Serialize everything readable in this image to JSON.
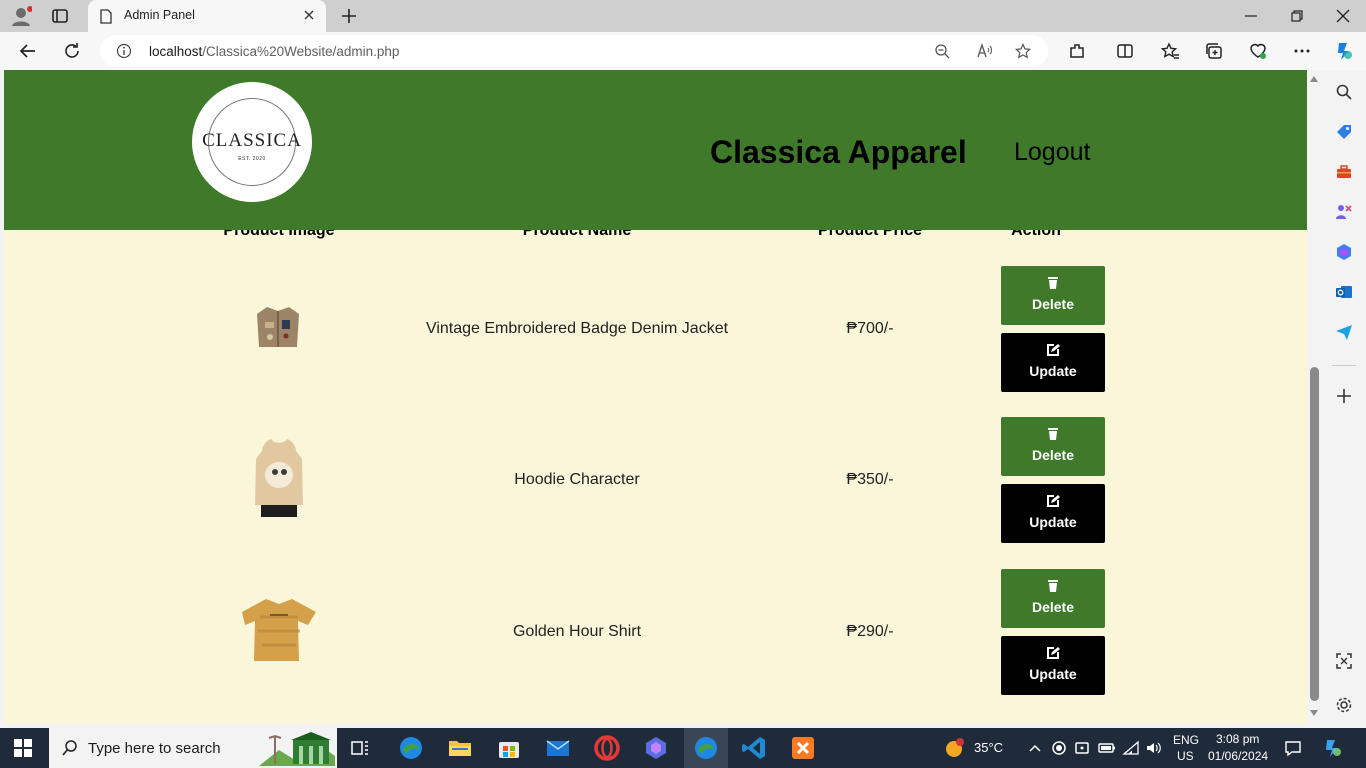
{
  "browser": {
    "tab_title": "Admin Panel",
    "url_host": "localhost",
    "url_path": "/Classica%20Website/admin.php"
  },
  "site": {
    "logo_brand": "CLASSICA",
    "logo_est": "EST. 2020",
    "title": "Classica Apparel",
    "logout": "Logout"
  },
  "table": {
    "headers": [
      "Product Image",
      "Product Name",
      "Product Price",
      "Action"
    ],
    "rows": [
      {
        "name": "Vintage Embroidered Badge Denim Jacket",
        "price": "₱700/-",
        "delete": "Delete",
        "update": "Update"
      },
      {
        "name": "Hoodie Character",
        "price": "₱350/-",
        "delete": "Delete",
        "update": "Update"
      },
      {
        "name": "Golden Hour Shirt",
        "price": "₱290/-",
        "delete": "Delete",
        "update": "Update"
      }
    ]
  },
  "taskbar": {
    "search_placeholder": "Type here to search",
    "weather": "35°C",
    "lang_top": "ENG",
    "lang_bottom": "US",
    "time": "3:08 pm",
    "date": "01/06/2024"
  },
  "colors": {
    "header_green": "#3f7a2b",
    "page_bg": "#faf6d9",
    "update_black": "#000000"
  }
}
